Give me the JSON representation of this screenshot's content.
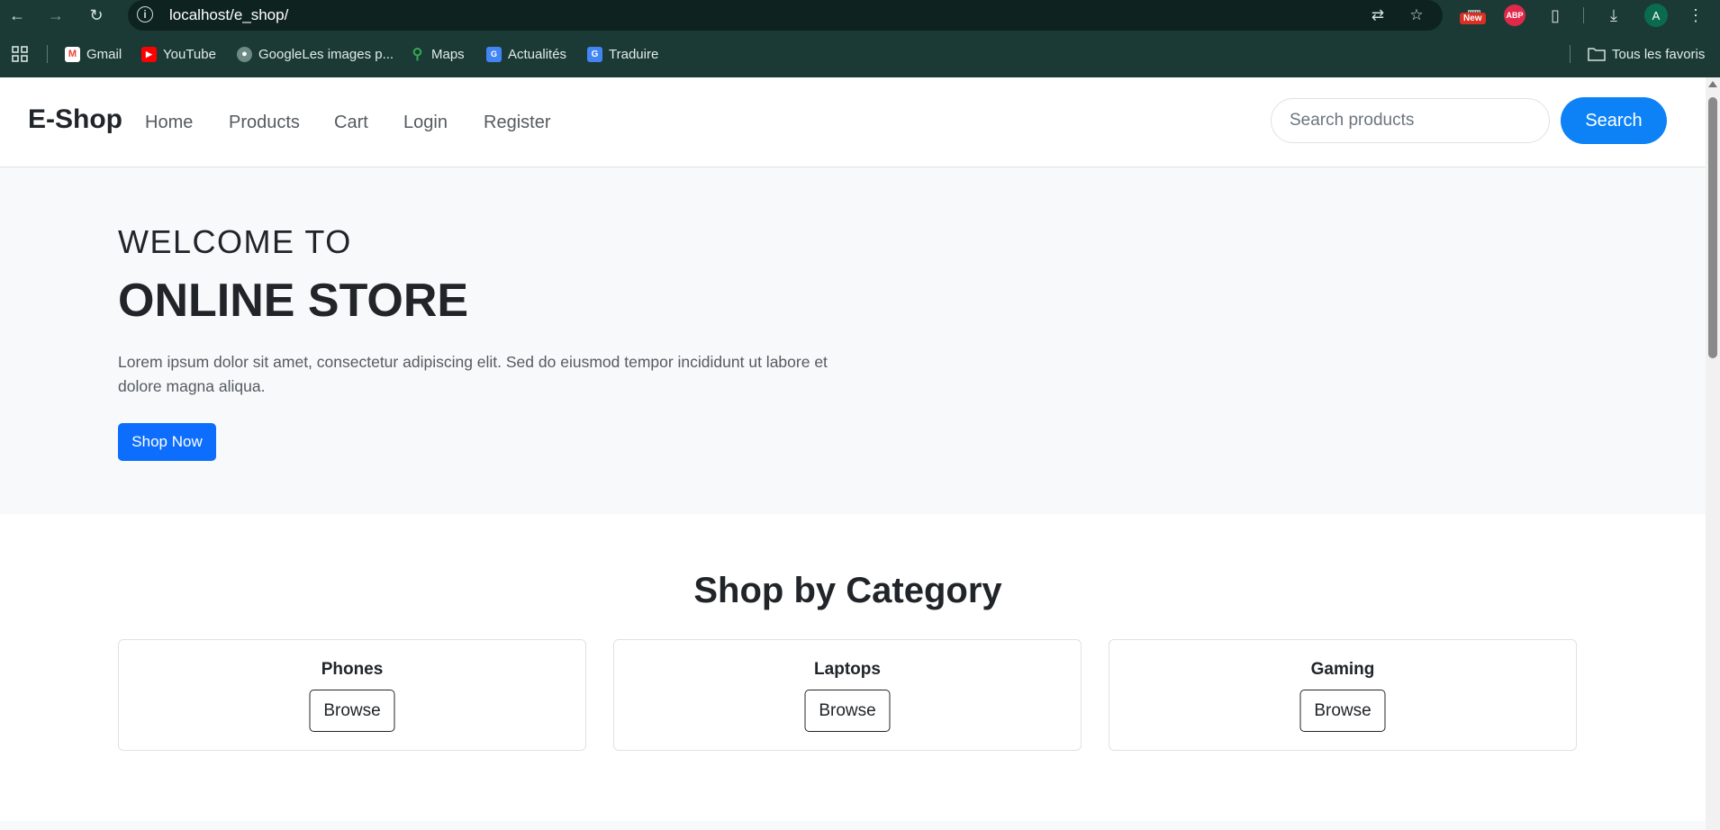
{
  "browser": {
    "url": "localhost/e_shop/",
    "new_badge": "New",
    "abp_label": "ABP",
    "avatar_letter": "A",
    "bookmarks": [
      {
        "label": "Gmail",
        "icon": "gmail-icon"
      },
      {
        "label": "YouTube",
        "icon": "youtube-icon"
      },
      {
        "label": "GoogleLes images p...",
        "icon": "globe-icon"
      },
      {
        "label": "Maps",
        "icon": "maps-icon"
      },
      {
        "label": "Actualités",
        "icon": "news-icon"
      },
      {
        "label": "Traduire",
        "icon": "translate-icon"
      }
    ],
    "all_bookmarks": "Tous les favoris"
  },
  "site": {
    "brand": "E-Shop",
    "nav": [
      "Home",
      "Products",
      "Cart",
      "Login",
      "Register"
    ],
    "search": {
      "placeholder": "Search products",
      "button": "Search"
    }
  },
  "hero": {
    "small_title": "WELCOME TO",
    "big_title": "ONLINE STORE",
    "text": "Lorem ipsum dolor sit amet, consectetur adipiscing elit. Sed do eiusmod tempor incididunt ut labore et dolore magna aliqua.",
    "button": "Shop Now"
  },
  "categories": {
    "title": "Shop by Category",
    "items": [
      {
        "name": "Phones",
        "button": "Browse"
      },
      {
        "name": "Laptops",
        "button": "Browse"
      },
      {
        "name": "Gaming",
        "button": "Browse"
      }
    ]
  },
  "colors": {
    "chrome": "#1b3a35",
    "primary": "#0d6efd",
    "search_button": "#0d82f6",
    "hero_bg": "#f8f9fa"
  }
}
